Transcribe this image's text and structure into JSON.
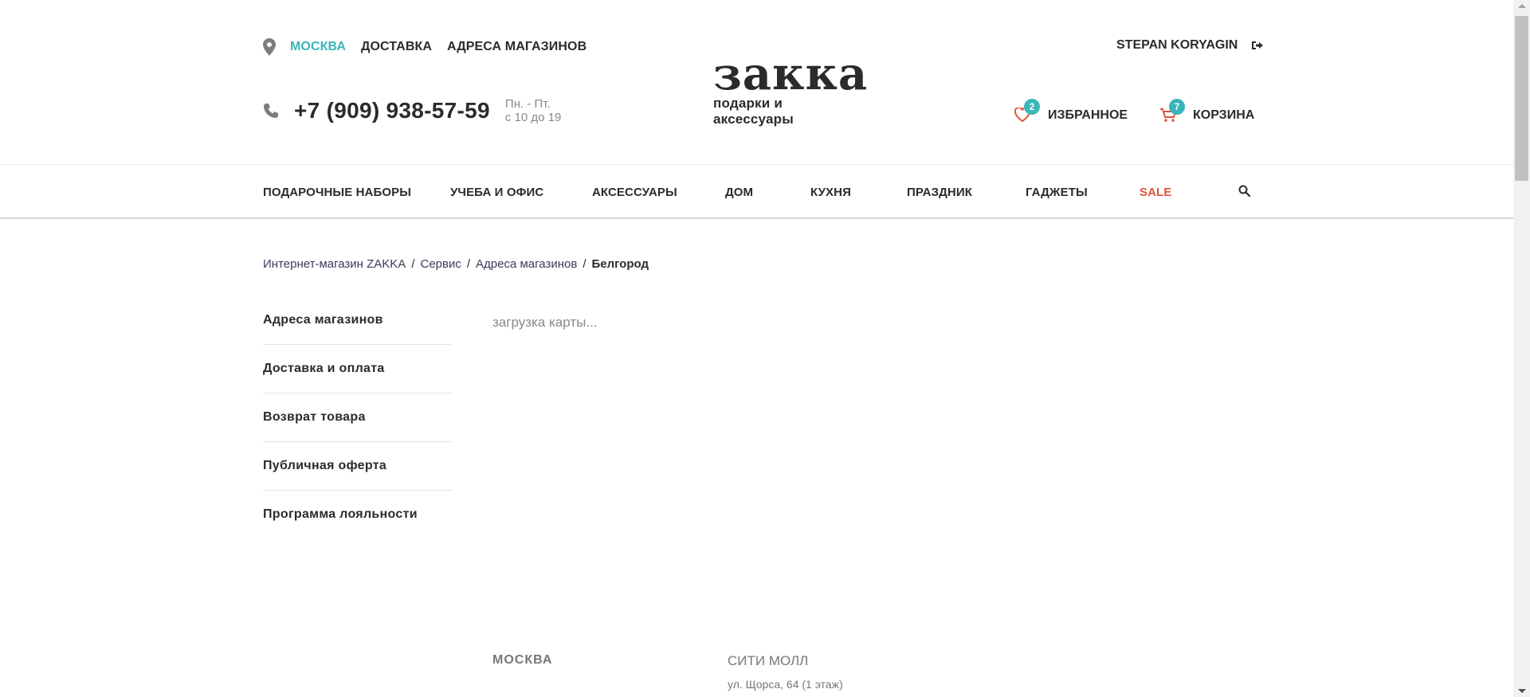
{
  "header": {
    "links": [
      "МОСКВА",
      "ДОСТАВКА",
      "АДРЕСА МАГАЗИНОВ"
    ],
    "phone": "+7 (909) 938-57-59",
    "hours_line1": "Пн. - Пт.",
    "hours_line2": "с 10 до 19",
    "logo_word": "закка",
    "logo_sub": "подарки и аксессуары",
    "user_name": "STEPAN KORYAGIN",
    "favorites_label": "ИЗБРАННОЕ",
    "favorites_count": "2",
    "cart_label": "КОРЗИНА",
    "cart_count": "7"
  },
  "nav": {
    "items": [
      "ПОДАРОЧНЫЕ НАБОРЫ",
      "УЧЕБА И ОФИС",
      "АКСЕССУАРЫ",
      "ДОМ",
      "КУХНЯ",
      "ПРАЗДНИК",
      "ГАДЖЕТЫ",
      "SALE"
    ]
  },
  "breadcrumb": {
    "items": [
      "Интернет-магазин ZAKKA",
      "Сервис",
      "Адреса магазинов"
    ],
    "separator": "/",
    "current": "Белгород"
  },
  "sidebar": {
    "items": [
      "Адреса магазинов",
      "Доставка и оплата",
      "Возврат товара",
      "Публичная оферта",
      "Программа лояльности"
    ]
  },
  "map": {
    "loading_text": "загрузка карты..."
  },
  "stores": {
    "city": "МОСКВА",
    "name": "СИТИ МОЛЛ",
    "address": "ул. Щорса, 64 (1 этаж)"
  },
  "colors": {
    "accent": "#3ab5b8",
    "sale": "#e0533c",
    "icon_red": "#e0533c"
  }
}
